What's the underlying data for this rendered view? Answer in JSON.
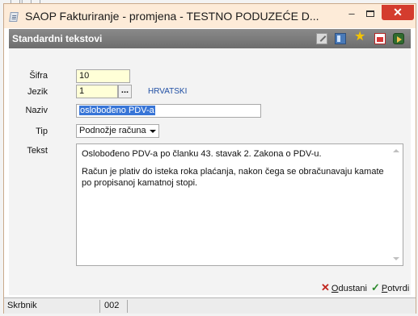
{
  "background_text": "I . II . I . I . . . .",
  "window": {
    "title": "SAOP Fakturiranje - promjena - TESTNO PODUZEĆE D...",
    "minimize_label": "–",
    "close_label": "✕"
  },
  "panel": {
    "title": "Standardni tekstovi",
    "toolbar_icons": [
      "edit-icon",
      "view-icon",
      "star-icon",
      "document-icon",
      "exit-icon"
    ]
  },
  "form": {
    "sifra": {
      "label": "Šifra",
      "value": "10"
    },
    "jezik": {
      "label": "Jezik",
      "value": "1",
      "button": "...",
      "language_name": "HRVATSKI"
    },
    "naziv": {
      "label": "Naziv",
      "value": "oslobođeno PDV-a"
    },
    "tip": {
      "label": "Tip",
      "value": "Podnožje računa"
    },
    "tekst": {
      "label": "Tekst",
      "line1": "Oslobođeno PDV-a po članku 43. stavak 2. Zakona o PDV-u.",
      "line2": "Račun je plativ do isteka roka plaćanja, nakon čega se obračunavaju kamate po propisanoj kamatnoj stopi."
    }
  },
  "actions": {
    "cancel": {
      "prefix": "O",
      "rest": "dustani"
    },
    "confirm": {
      "prefix": "P",
      "rest": "otvrdi"
    }
  },
  "statusbar": {
    "user": "Skrbnik",
    "code": "002"
  },
  "colors": {
    "titlebar": "#fdebd8",
    "panelbar": "#6d6d6d",
    "close": "#d43c2e",
    "selection": "#3875d7",
    "language_link": "#1f4ea3"
  }
}
